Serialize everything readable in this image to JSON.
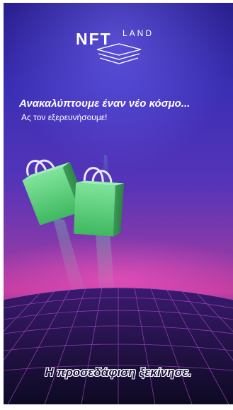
{
  "app": {
    "logo_main": "NFT",
    "logo_sub": "LAND"
  },
  "splash": {
    "headline": "Ανακαλύπτουμε έναν νέο κόσμο...",
    "subline": "Ας τον εξερευνήσουμε!",
    "loading_text": "Η προσεδάφιση ξεκίνησε."
  },
  "icons": [
    "nftland-logo-icon",
    "shopping-bag-icon"
  ],
  "colors": {
    "background_top": "#2a1f8e",
    "background_mid": "#c23c9e",
    "background_bottom": "#120d2a",
    "bag_green": "#5fd07a",
    "grid_line": "#b04ad0",
    "text": "#ffffff"
  }
}
